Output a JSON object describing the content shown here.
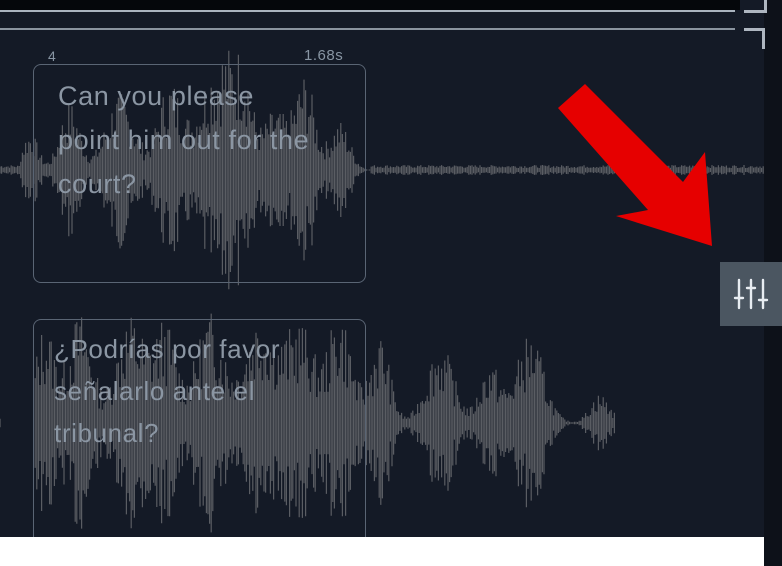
{
  "segment": {
    "index": "4",
    "duration": "1.68s",
    "source_text": "Can you please\npoint him out for the\ncourt?",
    "target_text": "¿Podrías por favor\nseñalarlo ante el\ntribunal?"
  },
  "controls": {
    "settings_icon": "sliders-icon"
  },
  "annotation": {
    "arrow_color": "#e60000"
  },
  "colors": {
    "background": "#141a26",
    "waveform": "#5a5d63",
    "card_border": "#5a6574",
    "button": "#4b5661"
  }
}
